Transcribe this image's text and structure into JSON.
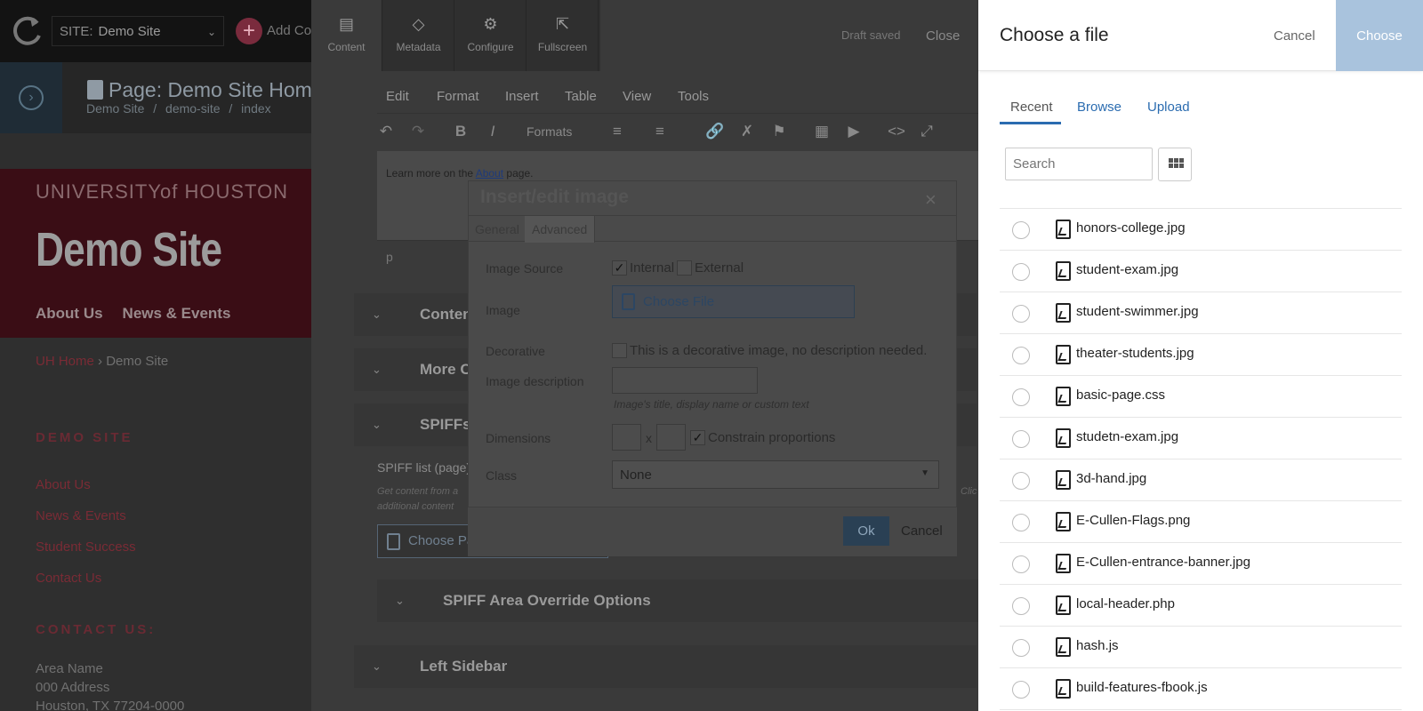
{
  "topbar": {
    "site_label": "SITE:",
    "site_value": "Demo Site",
    "add_content_label": "Add Co"
  },
  "page_header": {
    "title": "Page: Demo Site Home",
    "breadcrumbs": [
      "Demo Site",
      "/",
      "demo-site",
      "/",
      "index"
    ]
  },
  "preview": {
    "university": "UNIVERSITYof HOUSTON",
    "site_title": "Demo Site",
    "nav": [
      "About Us",
      "News & Events"
    ],
    "crumb_home": "UH Home",
    "crumb_sep": "›",
    "crumb_current": "Demo Site",
    "sidebar_heading": "DEMO SITE",
    "sidebar_links": [
      "About Us",
      "News & Events",
      "Student Success",
      "Contact Us"
    ],
    "contact_heading": "CONTACT US:",
    "address": [
      "Area Name",
      "000 Address",
      "Houston, TX 77204-0000"
    ]
  },
  "editor": {
    "tabs": [
      {
        "label": "Content",
        "icon": "content-icon"
      },
      {
        "label": "Metadata",
        "icon": "tag-icon"
      },
      {
        "label": "Configure",
        "icon": "gear-icon"
      },
      {
        "label": "Fullscreen",
        "icon": "expand-icon"
      }
    ],
    "draft_status": "Draft saved",
    "close_label": "Close",
    "menu": [
      "Edit",
      "Format",
      "Insert",
      "Table",
      "View",
      "Tools"
    ],
    "formats_label": "Formats",
    "rte_text_before": "Learn more on the ",
    "rte_link": "About",
    "rte_text_after": " page.",
    "status_path": "p",
    "sections": [
      "Content",
      "More C",
      "SPIFFs"
    ],
    "spiff_list_label": "SPIFF list (page)",
    "spiff_desc_1": "Get content from a",
    "spiff_desc_2": "additional content",
    "spiff_desc_right": "Clic",
    "choose_page_label": "Choose Pa",
    "override_section": "SPIFF Area Override Options",
    "left_sidebar_section": "Left Sidebar"
  },
  "modal": {
    "title": "Insert/edit image",
    "tabs": [
      "General",
      "Advanced"
    ],
    "image_source_label": "Image Source",
    "internal_label": "Internal",
    "external_label": "External",
    "internal_checked": true,
    "external_checked": false,
    "image_label": "Image",
    "choose_file_label": "Choose File",
    "decorative_label": "Decorative",
    "decorative_text": "This is a decorative image, no description needed.",
    "description_label": "Image description",
    "description_value": "",
    "description_hint": "Image's title, display name or custom text",
    "dimensions_label": "Dimensions",
    "dim_separator": "x",
    "constrain_label": "Constrain proportions",
    "constrain_checked": true,
    "class_label": "Class",
    "class_value": "None",
    "ok_label": "Ok",
    "cancel_label": "Cancel"
  },
  "panel": {
    "title": "Choose a file",
    "cancel_label": "Cancel",
    "choose_label": "Choose",
    "tabs": [
      "Recent",
      "Browse",
      "Upload"
    ],
    "active_tab": "Recent",
    "search_placeholder": "Search",
    "files": [
      "honors-college.jpg",
      "student-exam.jpg",
      "student-swimmer.jpg",
      "theater-students.jpg",
      "basic-page.css",
      "studetn-exam.jpg",
      "3d-hand.jpg",
      "E-Cullen-Flags.png",
      "E-Cullen-entrance-banner.jpg",
      "local-header.php",
      "hash.js",
      "build-features-fbook.js"
    ]
  },
  "colors": {
    "accent": "#2b6cb0",
    "choose_button": "#a9c3dd",
    "brand_red": "#c8102e"
  }
}
